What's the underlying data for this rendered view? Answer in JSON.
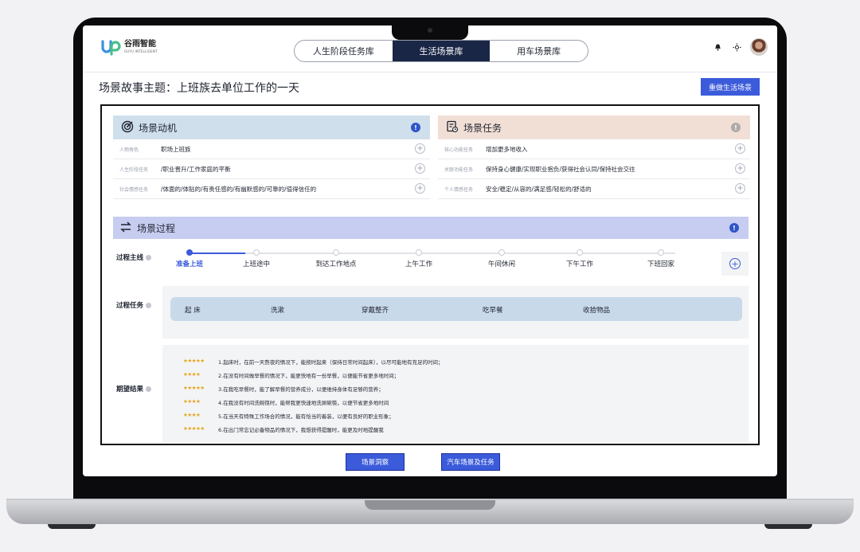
{
  "app": {
    "logo_cn": "谷雨智能",
    "logo_en": "GUYU INTELLIGENT"
  },
  "tabs": [
    {
      "label": "人生阶段任务库",
      "active": false
    },
    {
      "label": "生活场景库",
      "active": true
    },
    {
      "label": "用车场景库",
      "active": false
    }
  ],
  "header_icons": [
    "bell-icon",
    "sun-icon"
  ],
  "page": {
    "title": "场景故事主题：上班族去单位工作的一天",
    "redo_label": "重做生活场景"
  },
  "motivation": {
    "title": "场景动机",
    "rows": [
      {
        "label": "人物角色",
        "value": "职场上班族"
      },
      {
        "label": "人生阶段任务",
        "value": "/职业晋升/工作家庭的平衡"
      },
      {
        "label": "社会情感任务",
        "value": "/体面的/体贴的/有责任感的/有幽默感的/可靠的/值得信任的"
      }
    ]
  },
  "tasks": {
    "title": "场景任务",
    "rows": [
      {
        "label": "核心功能任务",
        "value": "增加更多地收入"
      },
      {
        "label": "关联功能任务",
        "value": "保持身心健康/实现职业抱负/获得社会认同/保持社会交往"
      },
      {
        "label": "个人情感任务",
        "value": "安全/稳定/从容的/满足感/轻松的/舒适的"
      }
    ]
  },
  "process": {
    "title": "场景过程",
    "mainline_label": "过程主线",
    "task_label": "过程任务",
    "result_label": "期望结果",
    "stages": [
      "准备上班",
      "上班途中",
      "到达工作地点",
      "上午工作",
      "午间休闲",
      "下午工作",
      "下班回家"
    ],
    "active_stage": 0,
    "tasks": [
      "起  床",
      "洗漱",
      "穿戴整齐",
      "吃早餐",
      "收拾物品"
    ],
    "results": [
      {
        "stars": "★★★★★",
        "text": "1.起床时，在前一天熬夜的情况下，能按时起来（保持日常时间起床），以尽可能地有充足的时间；"
      },
      {
        "stars": "★★★★",
        "text": "2.在没有时间做早餐的情况下，能更快地有一份早餐，以便能节省更多地时间；"
      },
      {
        "stars": "★★★★★",
        "text": "3.在我吃早餐时，能了解早餐的营养成分，以便维持身体有足够的营养；"
      },
      {
        "stars": "★★★★",
        "text": "4.在我没有时间洗碗筷时，能帮我更快速地洗涮碗筷，以便节省更多地时间"
      },
      {
        "stars": "★★★★",
        "text": "5.在当天有特殊工作场合的情况，能有恰当的着装，以便有良好的职业形象；"
      },
      {
        "stars": "★★★★★",
        "text": "6.在出门常忘记必备物品的情况下，我想获得提醒时，能更及时地提醒我"
      }
    ]
  },
  "bottom": {
    "insight_label": "场景洞察",
    "car_label": "汽车场景及任务"
  },
  "colors": {
    "accent": "#3b5bdb",
    "tab_active": "#1a2646",
    "motivation_head": "#cfdfec",
    "tasks_head": "#f1dfd5",
    "process_head": "#c7cdf0",
    "task_bar": "#c8d9ea",
    "star": "#e7a418"
  }
}
